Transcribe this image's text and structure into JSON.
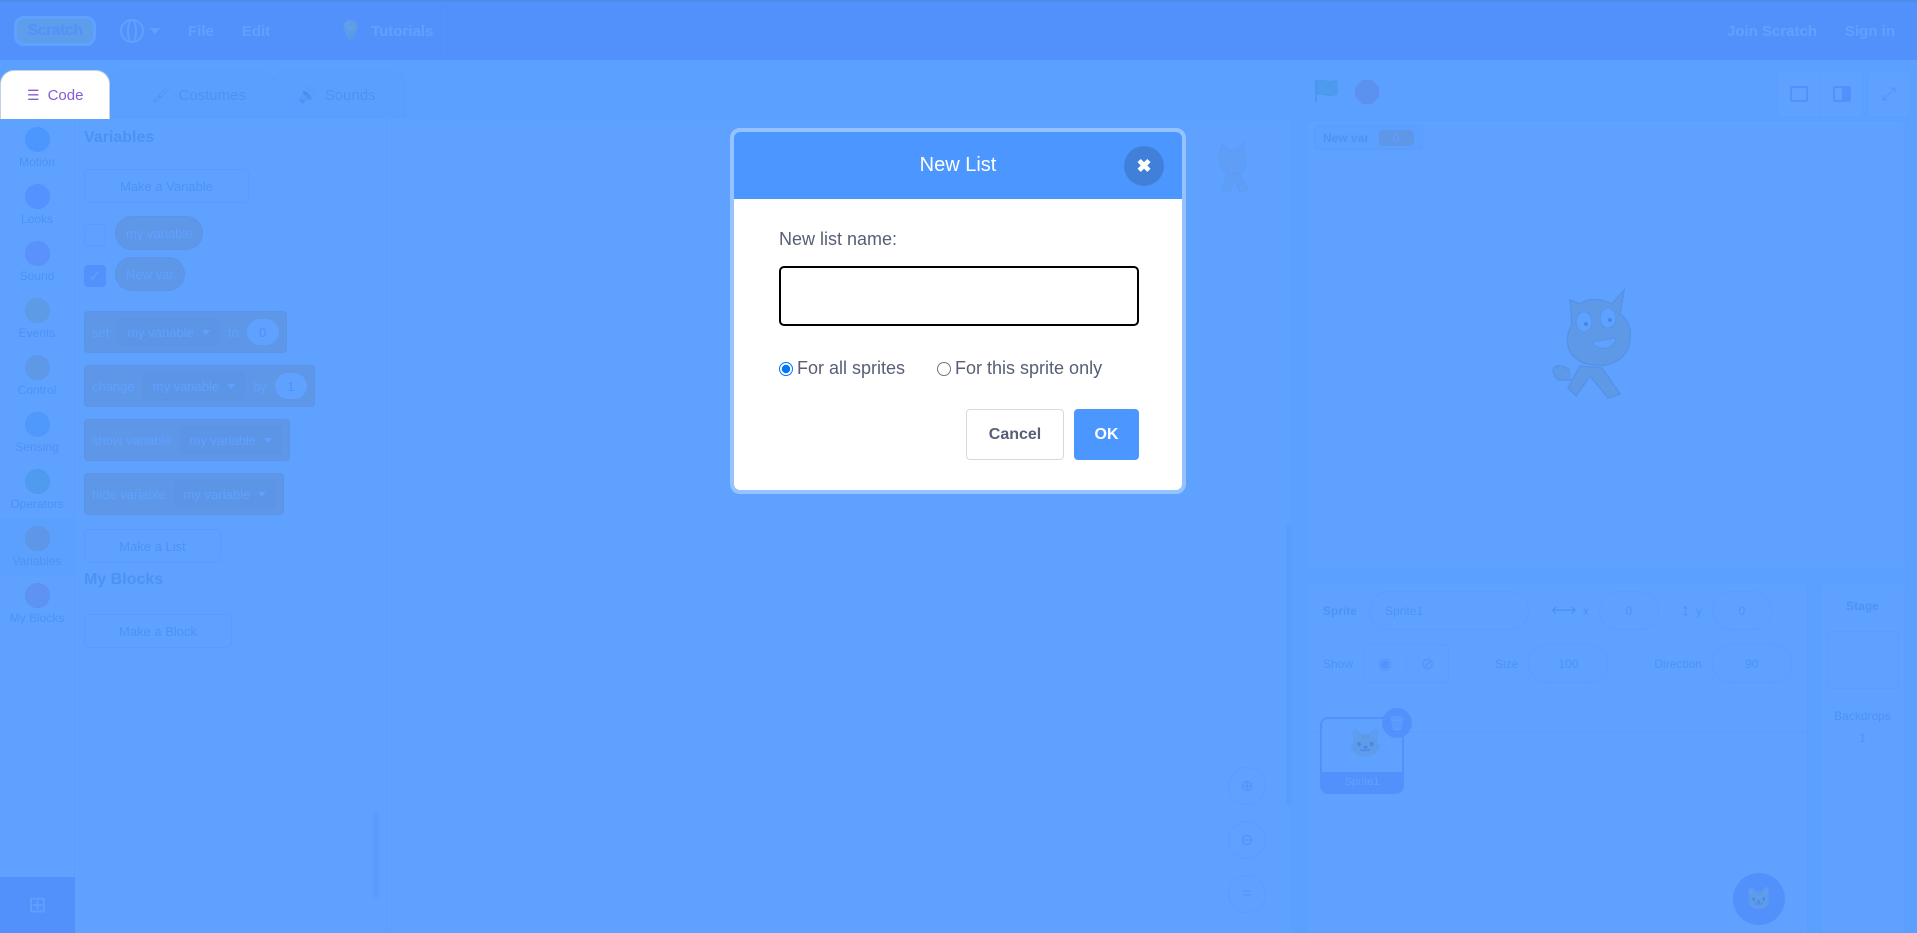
{
  "menubar": {
    "logo": "Scratch",
    "items": [
      {
        "label": "File"
      },
      {
        "label": "Edit"
      },
      {
        "label": "Tutorials"
      }
    ],
    "join": "Join Scratch",
    "signin": "Sign in"
  },
  "tabs": [
    {
      "label": "Code",
      "active": true
    },
    {
      "label": "Costumes"
    },
    {
      "label": "Sounds"
    }
  ],
  "categories": [
    {
      "label": "Motion",
      "color": "#4c97ff"
    },
    {
      "label": "Looks",
      "color": "#9966ff"
    },
    {
      "label": "Sound",
      "color": "#cf63cf"
    },
    {
      "label": "Events",
      "color": "#ffbf00"
    },
    {
      "label": "Control",
      "color": "#ffab19"
    },
    {
      "label": "Sensing",
      "color": "#5cb1d6"
    },
    {
      "label": "Operators",
      "color": "#59c059"
    },
    {
      "label": "Variables",
      "color": "#ff8c1a"
    },
    {
      "label": "My Blocks",
      "color": "#ff6680"
    }
  ],
  "flyout": {
    "variables_title": "Variables",
    "make_variable": "Make a Variable",
    "variables": [
      {
        "name": "my variable",
        "checked": false
      },
      {
        "name": "New var",
        "checked": true
      }
    ],
    "blocks": {
      "set": {
        "verb": "set",
        "var": "my variable",
        "prep": "to",
        "value": "0"
      },
      "change": {
        "verb": "change",
        "var": "my variable",
        "prep": "by",
        "value": "1"
      },
      "show": {
        "verb": "show variable",
        "var": "my variable"
      },
      "hide": {
        "verb": "hide variable",
        "var": "my variable"
      }
    },
    "make_list": "Make a List",
    "myblocks_title": "My Blocks",
    "make_block": "Make a Block"
  },
  "stage": {
    "monitor": {
      "label": "New var",
      "value": "0"
    }
  },
  "sprite_info": {
    "sprite_label": "Sprite",
    "sprite_name": "Sprite1",
    "x_label": "x",
    "x_value": "0",
    "y_label": "y",
    "y_value": "0",
    "show_label": "Show",
    "size_label": "Size",
    "size_value": "100",
    "direction_label": "Direction",
    "direction_value": "90"
  },
  "sprites": [
    {
      "name": "Sprite1",
      "selected": true
    }
  ],
  "stage_panel": {
    "title": "Stage",
    "backdrops_label": "Backdrops",
    "backdrops_count": "1"
  },
  "dialog": {
    "title": "New List",
    "field_label": "New list name:",
    "input_value": "",
    "input_placeholder": "",
    "options": [
      {
        "label": "For all sprites",
        "selected": true
      },
      {
        "label": "For this sprite only",
        "selected": false
      }
    ],
    "cancel": "Cancel",
    "ok": "OK",
    "accent": "#4c97ff"
  }
}
